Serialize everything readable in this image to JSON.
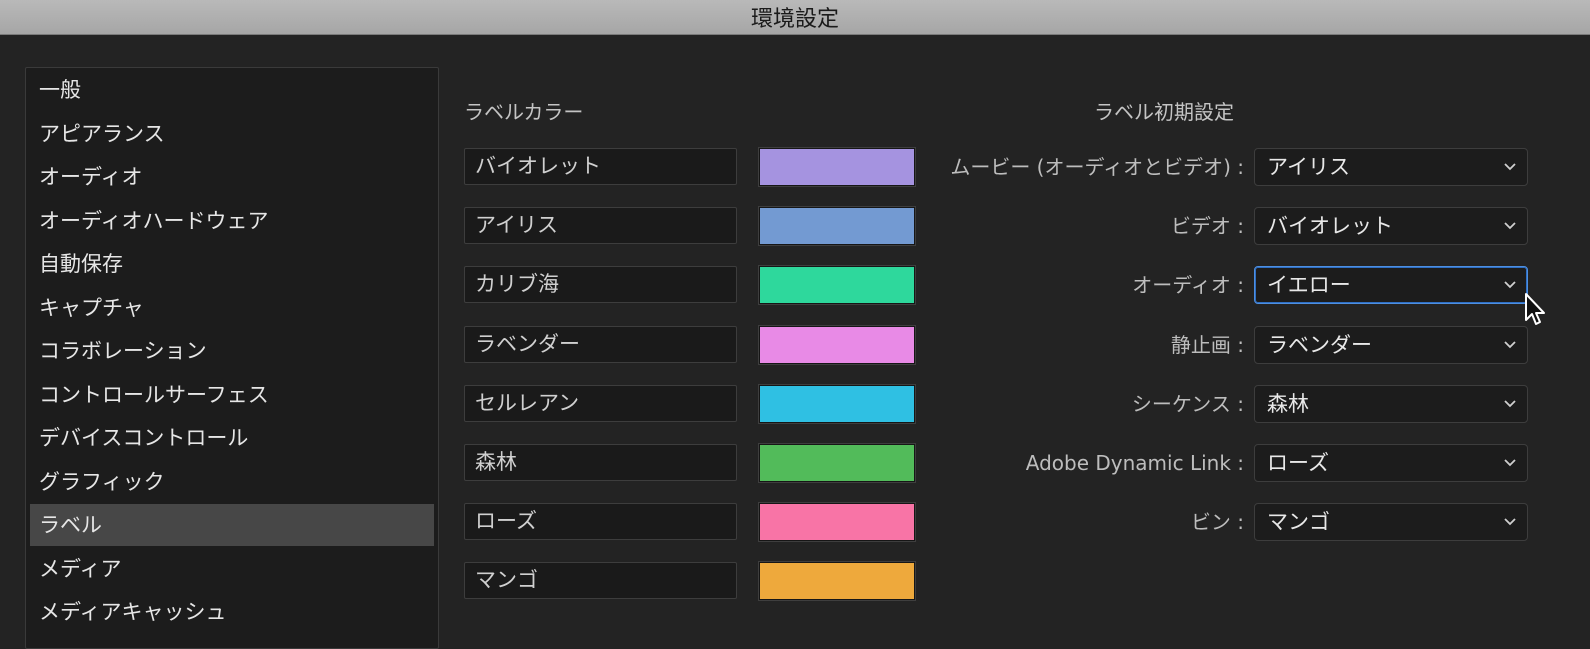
{
  "window": {
    "title": "環境設定"
  },
  "sidebar": {
    "items": [
      {
        "label": "一般",
        "selected": false
      },
      {
        "label": "アピアランス",
        "selected": false
      },
      {
        "label": "オーディオ",
        "selected": false
      },
      {
        "label": "オーディオハードウェア",
        "selected": false
      },
      {
        "label": "自動保存",
        "selected": false
      },
      {
        "label": "キャプチャ",
        "selected": false
      },
      {
        "label": "コラボレーション",
        "selected": false
      },
      {
        "label": "コントロールサーフェス",
        "selected": false
      },
      {
        "label": "デバイスコントロール",
        "selected": false
      },
      {
        "label": "グラフィック",
        "selected": false
      },
      {
        "label": "ラベル",
        "selected": true
      },
      {
        "label": "メディア",
        "selected": false
      },
      {
        "label": "メディアキャッシュ",
        "selected": false
      }
    ]
  },
  "label_colors": {
    "title": "ラベルカラー",
    "items": [
      {
        "name": "バイオレット",
        "color": "#a593e0"
      },
      {
        "name": "アイリス",
        "color": "#739ad2"
      },
      {
        "name": "カリブ海",
        "color": "#2ed89c"
      },
      {
        "name": "ラベンダー",
        "color": "#e88ae6"
      },
      {
        "name": "セルレアン",
        "color": "#2fc0e3"
      },
      {
        "name": "森林",
        "color": "#52bb5a"
      },
      {
        "name": "ローズ",
        "color": "#f874a6"
      },
      {
        "name": "マンゴ",
        "color": "#eea93c"
      }
    ]
  },
  "label_defaults": {
    "title": "ラベル初期設定",
    "items": [
      {
        "label": "ムービー (オーディオとビデオ) :",
        "value": "アイリス",
        "focused": false
      },
      {
        "label": "ビデオ :",
        "value": "バイオレット",
        "focused": false
      },
      {
        "label": "オーディオ :",
        "value": "イエロー",
        "focused": true
      },
      {
        "label": "静止画 :",
        "value": "ラベンダー",
        "focused": false
      },
      {
        "label": "シーケンス :",
        "value": "森林",
        "focused": false
      },
      {
        "label": "Adobe Dynamic Link :",
        "value": "ローズ",
        "focused": false
      },
      {
        "label": "ビン :",
        "value": "マンゴ",
        "focused": false
      }
    ]
  },
  "icons": {
    "dropdown": "chevron-down-icon",
    "cursor": "mouse-pointer-icon"
  },
  "theme": {
    "focus_color": "#4e8fe0",
    "selected_bg": "#474747"
  }
}
